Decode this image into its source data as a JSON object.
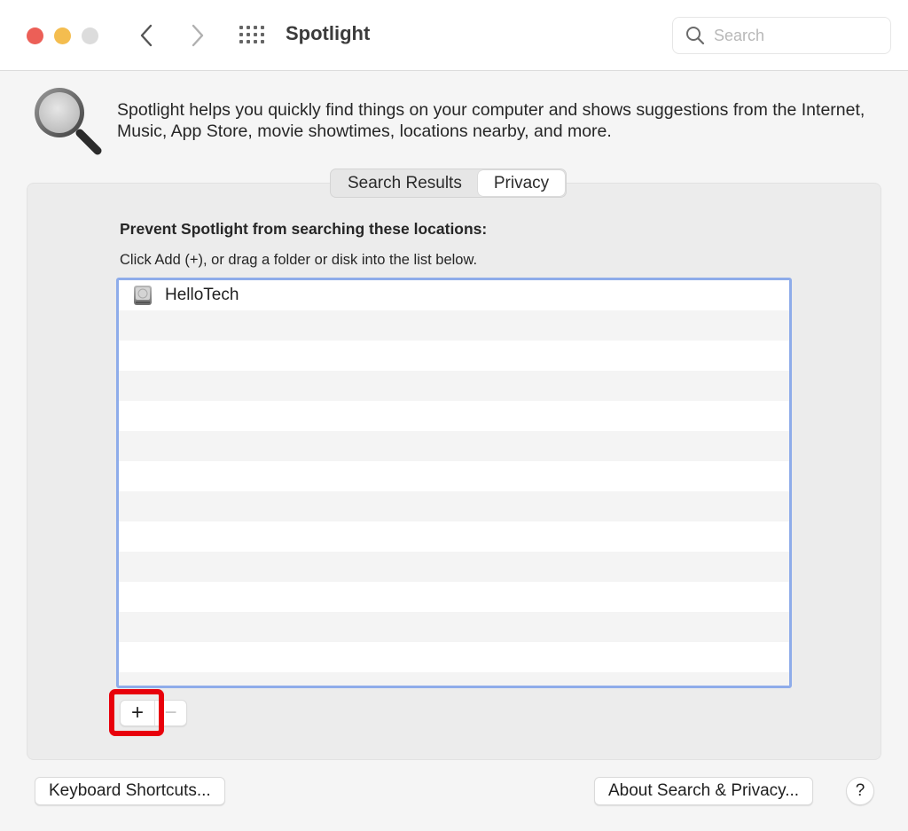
{
  "window": {
    "title": "Spotlight",
    "controls": [
      "close",
      "minimize",
      "zoom"
    ]
  },
  "toolbar": {
    "back_icon": "chevron-left-icon",
    "forward_icon": "chevron-right-icon",
    "grid_icon": "show-all-grid-icon",
    "search": {
      "placeholder": "Search",
      "value": ""
    }
  },
  "intro": {
    "icon": "magnifying-glass-icon",
    "text": "Spotlight helps you quickly find things on your computer and shows suggestions from the Internet, Music, App Store, movie showtimes, locations nearby, and more."
  },
  "tabs": [
    {
      "label": "Search Results",
      "active": false
    },
    {
      "label": "Privacy",
      "active": true
    }
  ],
  "privacy": {
    "heading": "Prevent Spotlight from searching these locations:",
    "hint": "Click Add (+), or drag a folder or disk into the list below.",
    "locations": [
      {
        "label": "HelloTech",
        "icon": "hard-disk-icon"
      }
    ],
    "add_label": "+",
    "remove_label": "−"
  },
  "footer": {
    "keyboard_shortcuts": "Keyboard Shortcuts...",
    "about": "About Search & Privacy...",
    "help": "?"
  },
  "colors": {
    "close": "#ec5f57",
    "minimize": "#f4bd4f",
    "zoom_disabled": "#dcdcdc",
    "list_focus_ring": "#8eacea",
    "annotation_highlight": "#e8000b"
  }
}
